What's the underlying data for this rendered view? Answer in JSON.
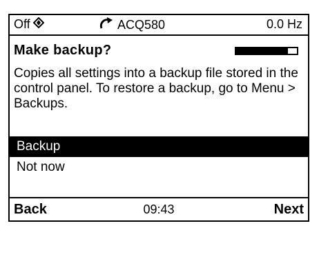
{
  "status": {
    "mode": "Off",
    "mode_icon": "diamond-direction-icon",
    "rotation_icon": "clockwise-arrow-icon",
    "drive_name": "ACQ580",
    "frequency": "0.0 Hz"
  },
  "dialog": {
    "title": "Make backup?",
    "progress_fraction": 0.85,
    "description": "Copies all settings into a backup file stored in the control panel. To restore a backup, go to Menu > Backups."
  },
  "options": [
    {
      "label": "Backup",
      "selected": true
    },
    {
      "label": "Not now",
      "selected": false
    }
  ],
  "footer": {
    "back_label": "Back",
    "time": "09:43",
    "next_label": "Next"
  },
  "colors": {
    "foreground": "#000000",
    "background": "#ffffff"
  }
}
